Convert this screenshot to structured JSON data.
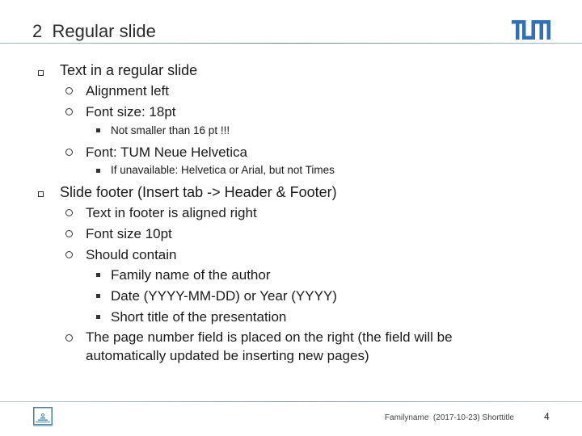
{
  "slide": {
    "title": "2  Regular slide",
    "logo_icon": "tum-logo-icon",
    "bullets": [
      {
        "level": 1,
        "marker": "square",
        "text": "Text in a regular slide"
      },
      {
        "level": 2,
        "marker": "circle",
        "text": "Alignment left"
      },
      {
        "level": 2,
        "marker": "circle",
        "text": "Font size: 18pt"
      },
      {
        "level": 3,
        "marker": "small-square",
        "text": "Not smaller than 16 pt !!!"
      },
      {
        "level": 2,
        "marker": "circle",
        "text": "Font: TUM Neue Helvetica"
      },
      {
        "level": 3,
        "marker": "small-square",
        "text": "If unavailable: Helvetica or Arial, but not Times"
      },
      {
        "level": 1,
        "marker": "square",
        "text": "Slide footer (Insert tab -> Header & Footer)"
      },
      {
        "level": 2,
        "marker": "circle",
        "text": "Text in footer is aligned right"
      },
      {
        "level": 2,
        "marker": "circle",
        "text": "Font size 10pt"
      },
      {
        "level": 2,
        "marker": "circle",
        "text": "Should contain"
      },
      {
        "level": 3,
        "marker": "small-square",
        "text": "Family name of the author"
      },
      {
        "level": 3,
        "marker": "small-square",
        "text": "Date (YYYY-MM-DD)  or Year (YYYY)"
      },
      {
        "level": 3,
        "marker": "small-square",
        "text": "Short title of the presentation"
      },
      {
        "level": 2,
        "marker": "circle",
        "text": "The page number field is placed on the right (the field will be"
      },
      {
        "level": 2,
        "marker": "none",
        "text": "automatically updated be inserting new pages)"
      }
    ]
  },
  "footer": {
    "icon": "tum-building-icon",
    "text": "Familyname  (2017-10-23) Shorttitle",
    "page_number": "4"
  },
  "colors": {
    "tum_blue": "#3070b3",
    "rule": "#7f99a4",
    "icon": "#4a8aa8"
  }
}
